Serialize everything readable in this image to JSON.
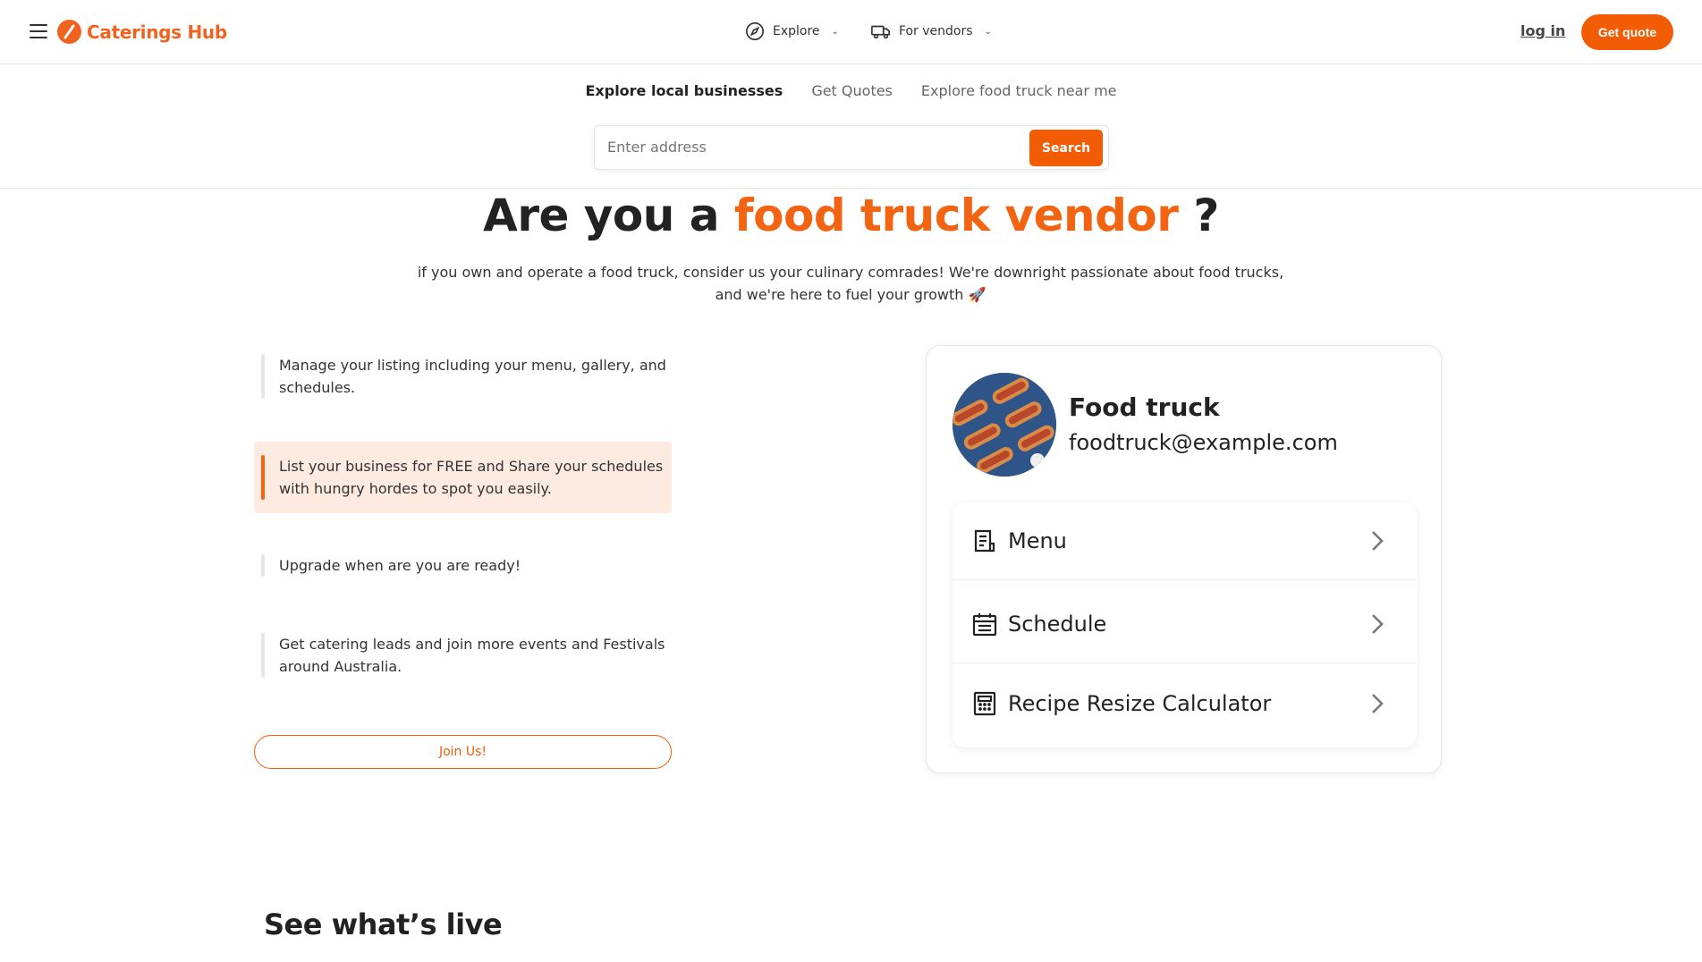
{
  "brand": {
    "name": "Caterings Hub",
    "accent_color": "#f25c05"
  },
  "header": {
    "nav": [
      {
        "label": "Explore",
        "icon": "compass-icon"
      },
      {
        "label": "For vendors",
        "icon": "truck-icon"
      }
    ],
    "login_label": "log in",
    "quote_label": "Get quote"
  },
  "subtabs": [
    "Explore local businesses",
    "Get Quotes",
    "Explore food truck near me"
  ],
  "search": {
    "placeholder": "Enter address",
    "button_label": "Search"
  },
  "hero": {
    "title_prefix": "Are you a",
    "title_accent": "food truck vendor",
    "title_suffix": "?",
    "description": "if you own and operate a food truck, consider us your culinary comrades! We're downright passionate about food trucks, and we're here to fuel your growth 🚀"
  },
  "features": [
    "Manage your listing including your menu, gallery, and schedules.",
    "List your business for FREE and Share your schedules with hungry hordes to spot you easily.",
    "Upgrade when are you are ready!",
    "Get catering leads and join more events and Festivals around Australia."
  ],
  "join_label": "Join Us!",
  "card": {
    "name": "Food truck",
    "email": "foodtruck@example.com",
    "items": [
      {
        "label": "Menu",
        "icon": "menu-document-icon"
      },
      {
        "label": "Schedule",
        "icon": "calendar-icon"
      },
      {
        "label": "Recipe Resize Calculator",
        "icon": "calculator-icon"
      }
    ]
  },
  "section_title": "See what’s live"
}
